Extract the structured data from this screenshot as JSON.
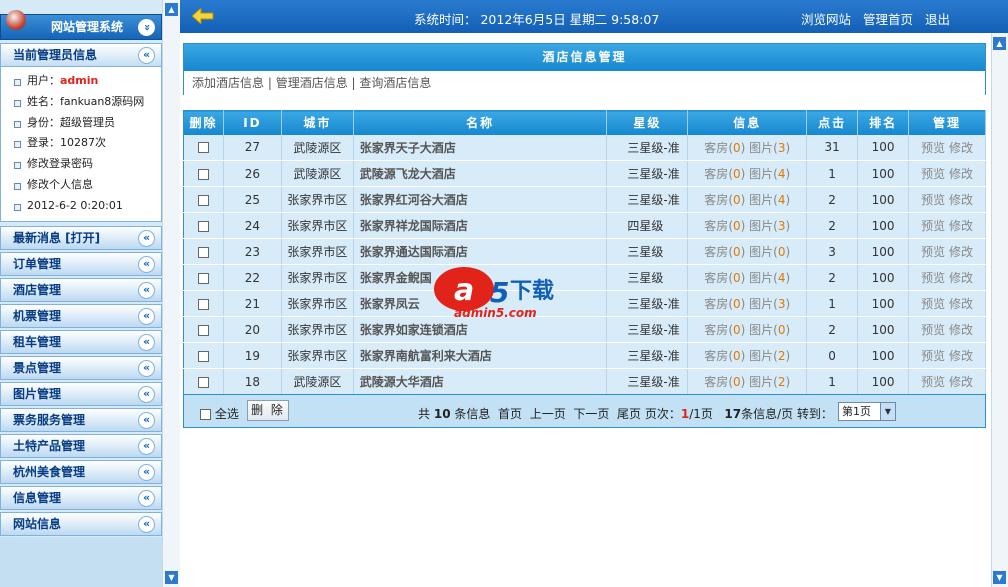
{
  "sidebar": {
    "title": "网站管理系统",
    "title_arrow": "»",
    "admin_panel": {
      "heading": "当前管理员信息",
      "arrow": "«",
      "user_label": "用户：",
      "user_value": "admin",
      "name": "姓名：fankuan8源码网",
      "role": "身份：超级管理员",
      "logins": "登录：10287次",
      "change_pwd": "修改登录密码",
      "edit_profile": "修改个人信息",
      "last_login": "2012-6-2 0:20:01"
    },
    "menu": [
      {
        "label": "最新消息 [打开]",
        "arrow": "«"
      },
      {
        "label": "订单管理",
        "arrow": "«"
      },
      {
        "label": "酒店管理",
        "arrow": "«"
      },
      {
        "label": "机票管理",
        "arrow": "«"
      },
      {
        "label": "租车管理",
        "arrow": "«"
      },
      {
        "label": "景点管理",
        "arrow": "«"
      },
      {
        "label": "图片管理",
        "arrow": "«"
      },
      {
        "label": "票务服务管理",
        "arrow": "«"
      },
      {
        "label": "土特产品管理",
        "arrow": "«"
      },
      {
        "label": "杭州美食管理",
        "arrow": "«"
      },
      {
        "label": "信息管理",
        "arrow": "«"
      },
      {
        "label": "网站信息",
        "arrow": "«"
      }
    ]
  },
  "topbar": {
    "system_time": "系统时间： 2012年6月5日 星期二 9:58:07",
    "links": [
      "浏览网站",
      "管理首页",
      "退出"
    ]
  },
  "hotel_section": {
    "title": "酒店信息管理",
    "links": [
      "添加酒店信息",
      "管理酒店信息",
      "查询酒店信息"
    ],
    "separator": " | "
  },
  "table": {
    "headers": [
      "删除",
      "ID",
      "城市",
      "名称",
      "星级",
      "信息",
      "点击",
      "排名",
      "管理"
    ],
    "rows": [
      {
        "id": "27",
        "city": "武陵源区",
        "name": "张家界天子大酒店",
        "star": "三星级-准",
        "rooms": "0",
        "pics": "3",
        "clicks": "31",
        "rank": "100"
      },
      {
        "id": "26",
        "city": "武陵源区",
        "name": "武陵源飞龙大酒店",
        "star": "三星级-准",
        "rooms": "0",
        "pics": "4",
        "clicks": "1",
        "rank": "100"
      },
      {
        "id": "25",
        "city": "张家界市区",
        "name": "张家界红河谷大酒店",
        "star": "三星级-准",
        "rooms": "0",
        "pics": "4",
        "clicks": "2",
        "rank": "100"
      },
      {
        "id": "24",
        "city": "张家界市区",
        "name": "张家界祥龙国际酒店",
        "star": "四星级",
        "rooms": "0",
        "pics": "3",
        "clicks": "2",
        "rank": "100"
      },
      {
        "id": "23",
        "city": "张家界市区",
        "name": "张家界通达国际酒店",
        "star": "三星级",
        "rooms": "0",
        "pics": "0",
        "clicks": "3",
        "rank": "100"
      },
      {
        "id": "22",
        "city": "张家界市区",
        "name": "张家界金鲵国",
        "star": "三星级",
        "rooms": "0",
        "pics": "4",
        "clicks": "2",
        "rank": "100"
      },
      {
        "id": "21",
        "city": "张家界市区",
        "name": "张家界凤云",
        "star": "三星级-准",
        "rooms": "0",
        "pics": "3",
        "clicks": "1",
        "rank": "100"
      },
      {
        "id": "20",
        "city": "张家界市区",
        "name": "张家界如家连锁酒店",
        "star": "三星级-准",
        "rooms": "0",
        "pics": "0",
        "clicks": "2",
        "rank": "100"
      },
      {
        "id": "19",
        "city": "张家界市区",
        "name": "张家界南航富利来大酒店",
        "star": "三星级-准",
        "rooms": "0",
        "pics": "2",
        "clicks": "0",
        "rank": "100"
      },
      {
        "id": "18",
        "city": "武陵源区",
        "name": "武陵源大华酒店",
        "star": "三星级-准",
        "rooms": "0",
        "pics": "2",
        "clicks": "1",
        "rank": "100"
      }
    ],
    "rooms_label": "客房",
    "pics_label": "图片",
    "preview_label": "预览",
    "edit_label": "修改"
  },
  "pager": {
    "select_all": "全选",
    "delete_button": "删 除",
    "total_prefix": "共",
    "total_count": "10",
    "total_suffix": "条信息",
    "first": "首页",
    "prev": "上一页",
    "next": "下一页",
    "last": "尾页",
    "page_label": "页次：",
    "current_page": "1",
    "total_pages": "/1页",
    "per_page_count": "17",
    "per_page_suffix": "条信息/页 转到：",
    "goto_value": "第1页"
  },
  "watermark": {
    "brand": "a5下载",
    "url": "admin5.com"
  },
  "colors": {
    "topbar": "#1a6fc4",
    "header": "#1687cf",
    "row_bg": "#d7ebf8",
    "accent_red": "#e2231a",
    "accent_orange": "#e07b00"
  }
}
